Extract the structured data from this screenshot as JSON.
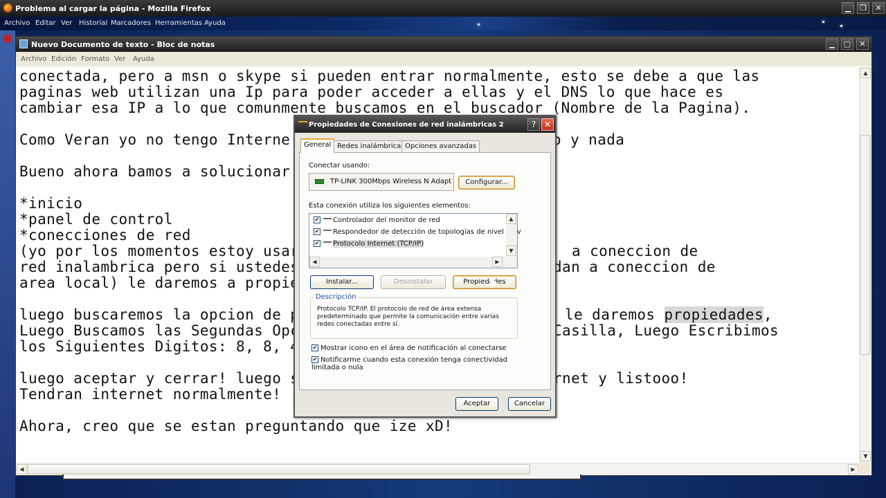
{
  "firefox": {
    "title": "Problema al cargar la página - Mozilla Firefox",
    "menu": [
      "Archivo",
      "Editar",
      "Ver",
      "Historial",
      "Marcadores",
      "Herramientas",
      "Ayuda"
    ]
  },
  "notepad": {
    "title": "Nuevo Documento de texto - Bloc de notas",
    "menu": [
      "Archivo",
      "Edición",
      "Formato",
      "Ver",
      "Ayuda"
    ],
    "lines": [
      "conectada, pero a msn o skype si pueden entrar normalmente, esto se debe a que las",
      "paginas web utilizan una Ip para poder acceder a ellas y el DNS lo que hace es",
      "cambiar esa IP a lo que comunmente buscamos en el buscador (Nombre de la Pagina).",
      "",
      "Como Veran yo no tengo Interne",
      "",
      "Bueno ahora bamos a solucionar",
      "",
      "*inicio",
      "*panel de control",
      "*conecciones de red",
      "(yo por los momentos estoy usar",
      "red inalambrica pero si ustedes",
      "area local) le daremos a propie",
      "",
      "luego buscaremos la opcion de p",
      "Luego Buscamos las Segundas Opc",
      "los Siguientes Digitos: 8, 8, 4",
      "",
      "luego aceptar y cerrar! luego s",
      "Tendran internet normalmente!",
      "",
      "Ahora, creo que se estan preguntando que ize xD!"
    ],
    "right_fragments": [
      {
        "row": 4,
        "text": "o y nada"
      },
      {
        "row": 11,
        "text": "a coneccion de"
      },
      {
        "row": 12,
        "text": "dan a coneccion de"
      },
      {
        "row": 15,
        "text": " le daremos "
      },
      {
        "row": 16,
        "text": "Casilla, Luego Escribimos"
      },
      {
        "row": 19,
        "text": "rnet y listooo!"
      }
    ],
    "highlighted_word": "propiedades",
    "highlighted_suffix": ","
  },
  "dialog": {
    "title": "Propiedades de Conexiones de red inalámbricas 2",
    "tabs": [
      "General",
      "Redes inalámbricas",
      "Opciones avanzadas"
    ],
    "connect_using_label": "Conectar usando:",
    "adapter_name": "TP-LINK 300Mbps Wireless N Adapt",
    "configure_button": "Configurar...",
    "elements_label": "Esta conexión utiliza los siguientes elementos:",
    "items": [
      {
        "label": "Controlador del monitor de red",
        "checked": true
      },
      {
        "label": "Respondedor de detección de topologías de nivel de v",
        "checked": true
      },
      {
        "label": "Protocolo Internet (TCP/IP)",
        "checked": true
      }
    ],
    "install_button": "Instalar...",
    "uninstall_button": "Desinstalar",
    "properties_button": "Propiedades",
    "description_legend": "Descripción",
    "description_text": "Protocolo TCP/IP. El protocolo de red de área extensa predeterminado que permite la comunicación entre varias redes conectadas entre sí.",
    "option1": "Mostrar icono en el área de notificación al conectarse",
    "option2": "Notificarme cuando esta conexión tenga conectividad limitada o nula",
    "ok_button": "Aceptar",
    "cancel_button": "Cancelar"
  }
}
